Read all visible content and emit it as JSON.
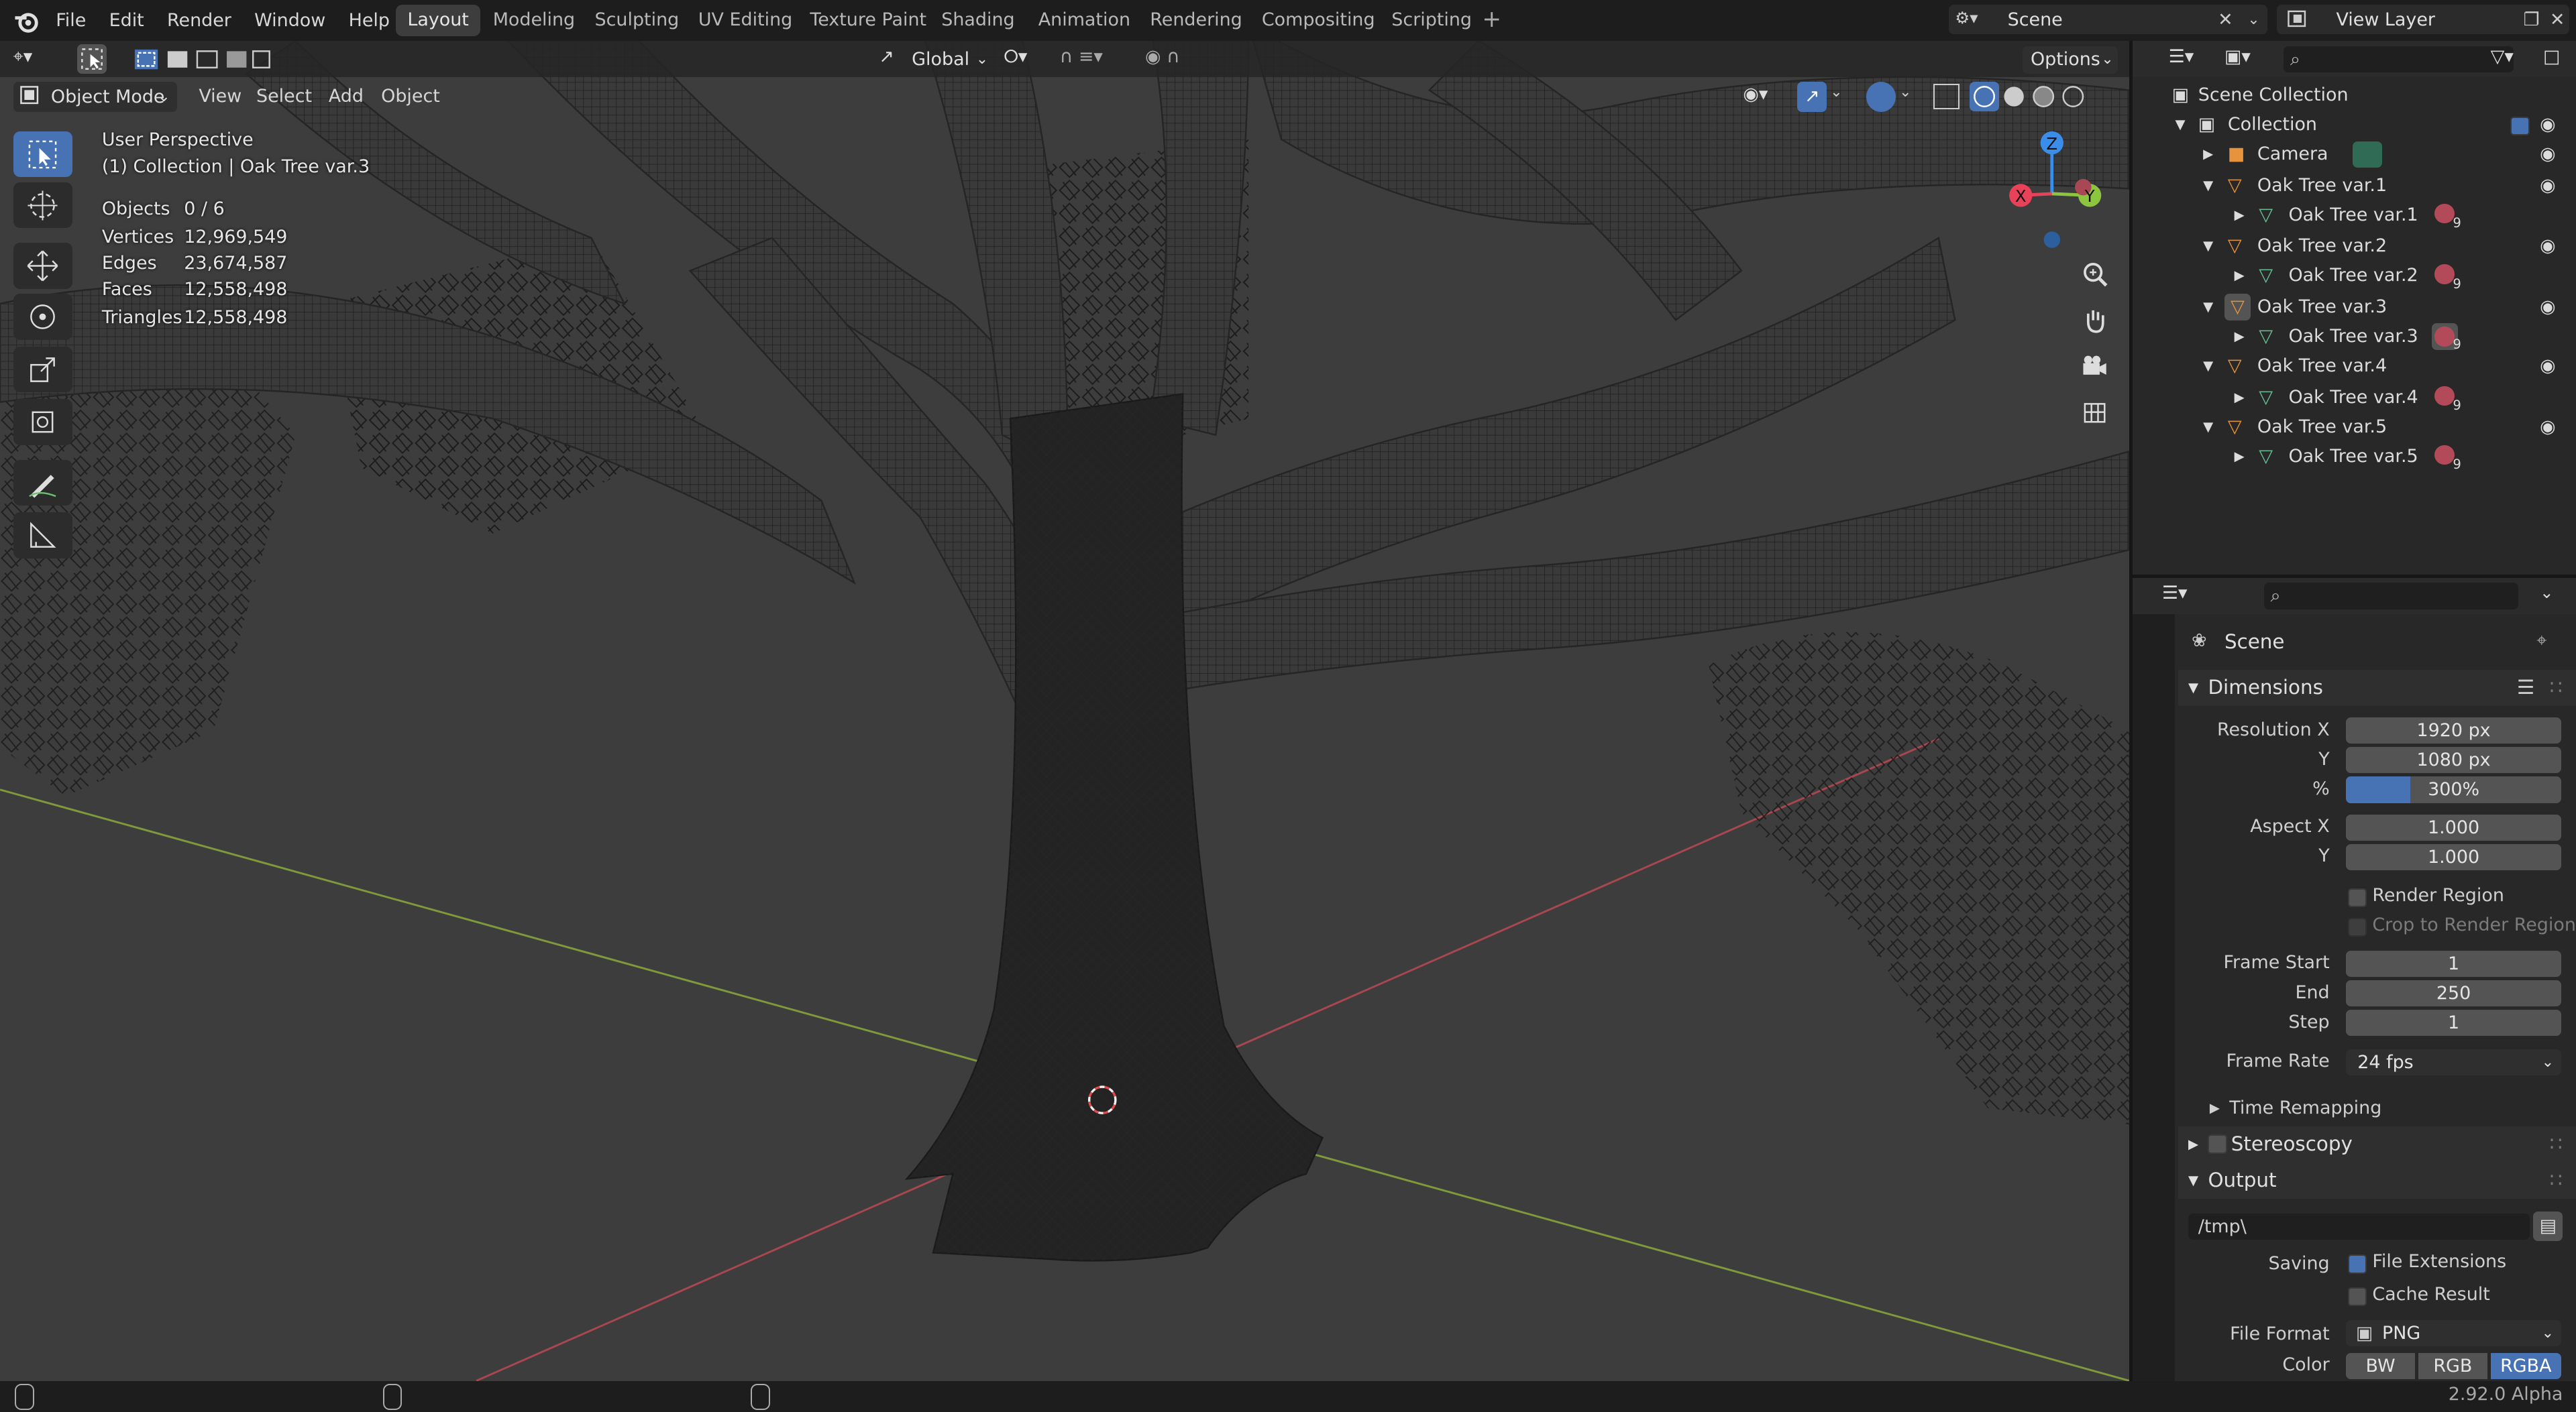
{
  "app": {
    "version": "2.92.0 Alpha"
  },
  "menu": [
    "File",
    "Edit",
    "Render",
    "Window",
    "Help"
  ],
  "workspaces": [
    "Layout",
    "Modeling",
    "Sculpting",
    "UV Editing",
    "Texture Paint",
    "Shading",
    "Animation",
    "Rendering",
    "Compositing",
    "Scripting"
  ],
  "active_workspace": "Layout",
  "scene_field": "Scene",
  "view_layer_field": "View Layer",
  "toolbar": {
    "orientation": "Global",
    "options_label": "Options"
  },
  "viewport_header": {
    "mode": "Object Mode",
    "menus": [
      "View",
      "Select",
      "Add",
      "Object"
    ]
  },
  "viewport_overlay": {
    "perspective": "User Perspective",
    "collection_info": "(1) Collection | Oak Tree var.3",
    "stats": [
      {
        "label": "Objects",
        "value": "0 / 6"
      },
      {
        "label": "Vertices",
        "value": "12,969,549"
      },
      {
        "label": "Edges",
        "value": "23,674,587"
      },
      {
        "label": "Faces",
        "value": "12,558,498"
      },
      {
        "label": "Triangles",
        "value": "12,558,498"
      }
    ],
    "gizmo": {
      "x": "X",
      "y": "Y",
      "z": "Z"
    }
  },
  "outliner": {
    "root": "Scene Collection",
    "collection": "Collection",
    "items": [
      {
        "name": "Camera",
        "child": null,
        "mat_count": ""
      },
      {
        "name": "Oak Tree var.1",
        "child": "Oak Tree var.1",
        "mat_count": "9"
      },
      {
        "name": "Oak Tree var.2",
        "child": "Oak Tree var.2",
        "mat_count": "9"
      },
      {
        "name": "Oak Tree var.3",
        "child": "Oak Tree var.3",
        "mat_count": "9"
      },
      {
        "name": "Oak Tree var.4",
        "child": "Oak Tree var.4",
        "mat_count": "9"
      },
      {
        "name": "Oak Tree var.5",
        "child": "Oak Tree var.5",
        "mat_count": "9"
      }
    ]
  },
  "properties": {
    "context": "Scene",
    "dimensions_header": "Dimensions",
    "resolution_x_label": "Resolution X",
    "resolution_x": "1920 px",
    "resolution_y_label": "Y",
    "resolution_y": "1080 px",
    "percent_label": "%",
    "percent": "300%",
    "percent_fraction": 0.3,
    "aspect_x_label": "Aspect X",
    "aspect_x": "1.000",
    "aspect_y_label": "Y",
    "aspect_y": "1.000",
    "render_region": "Render Region",
    "crop_region": "Crop to Render Region",
    "frame_start_label": "Frame Start",
    "frame_start": "1",
    "end_label": "End",
    "end": "250",
    "step_label": "Step",
    "step": "1",
    "frame_rate_label": "Frame Rate",
    "frame_rate": "24 fps",
    "time_remapping": "Time Remapping",
    "stereoscopy": "Stereoscopy",
    "output_header": "Output",
    "output_path": "/tmp\\",
    "saving_label": "Saving",
    "file_extensions": "File Extensions",
    "cache_result": "Cache Result",
    "file_format_label": "File Format",
    "file_format": "PNG",
    "color_label": "Color",
    "color_options": [
      "BW",
      "RGB",
      "RGBA"
    ],
    "color_selected": "RGBA"
  },
  "colors": {
    "accent": "#4772b3",
    "selection": "#334d80",
    "axis_x": "#e8415a",
    "axis_y": "#8cc63f",
    "axis_z": "#3a8eea",
    "object_orange": "#e7933e",
    "mesh_green": "#67c096"
  }
}
